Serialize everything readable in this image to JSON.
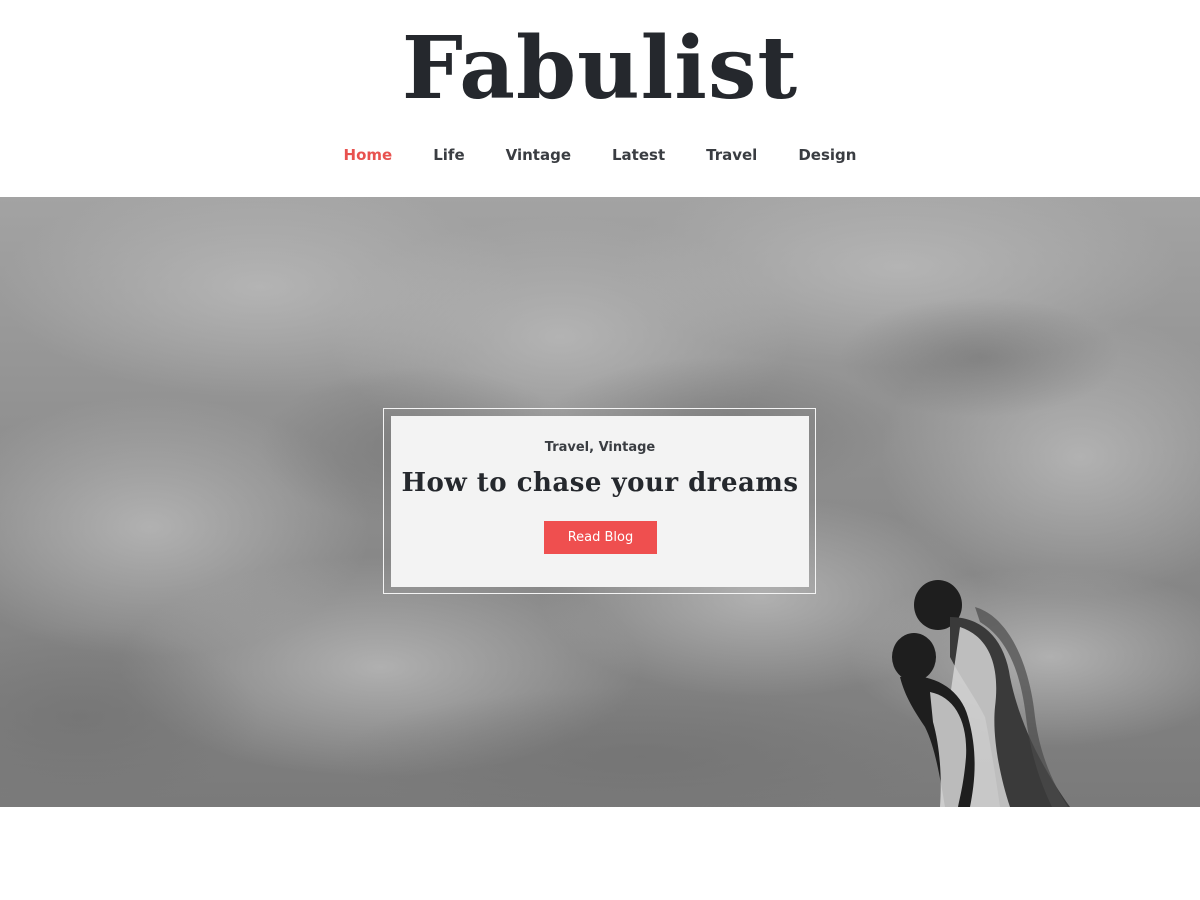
{
  "site": {
    "title": "Fabulist"
  },
  "nav": {
    "items": [
      {
        "label": "Home",
        "active": true
      },
      {
        "label": "Life",
        "active": false
      },
      {
        "label": "Vintage",
        "active": false
      },
      {
        "label": "Latest",
        "active": false
      },
      {
        "label": "Travel",
        "active": false
      },
      {
        "label": "Design",
        "active": false
      }
    ]
  },
  "hero": {
    "categories": [
      "Travel",
      "Vintage"
    ],
    "category_separator": ", ",
    "title": "How to chase your dreams",
    "button_label": "Read Blog",
    "image_description_icon": "couple-silhouette-against-cloudy-sky"
  },
  "colors": {
    "accent": "#ef4f4f",
    "nav_active": "#e8524f",
    "text_dark": "#25282d",
    "card_bg": "#f3f3f3"
  }
}
